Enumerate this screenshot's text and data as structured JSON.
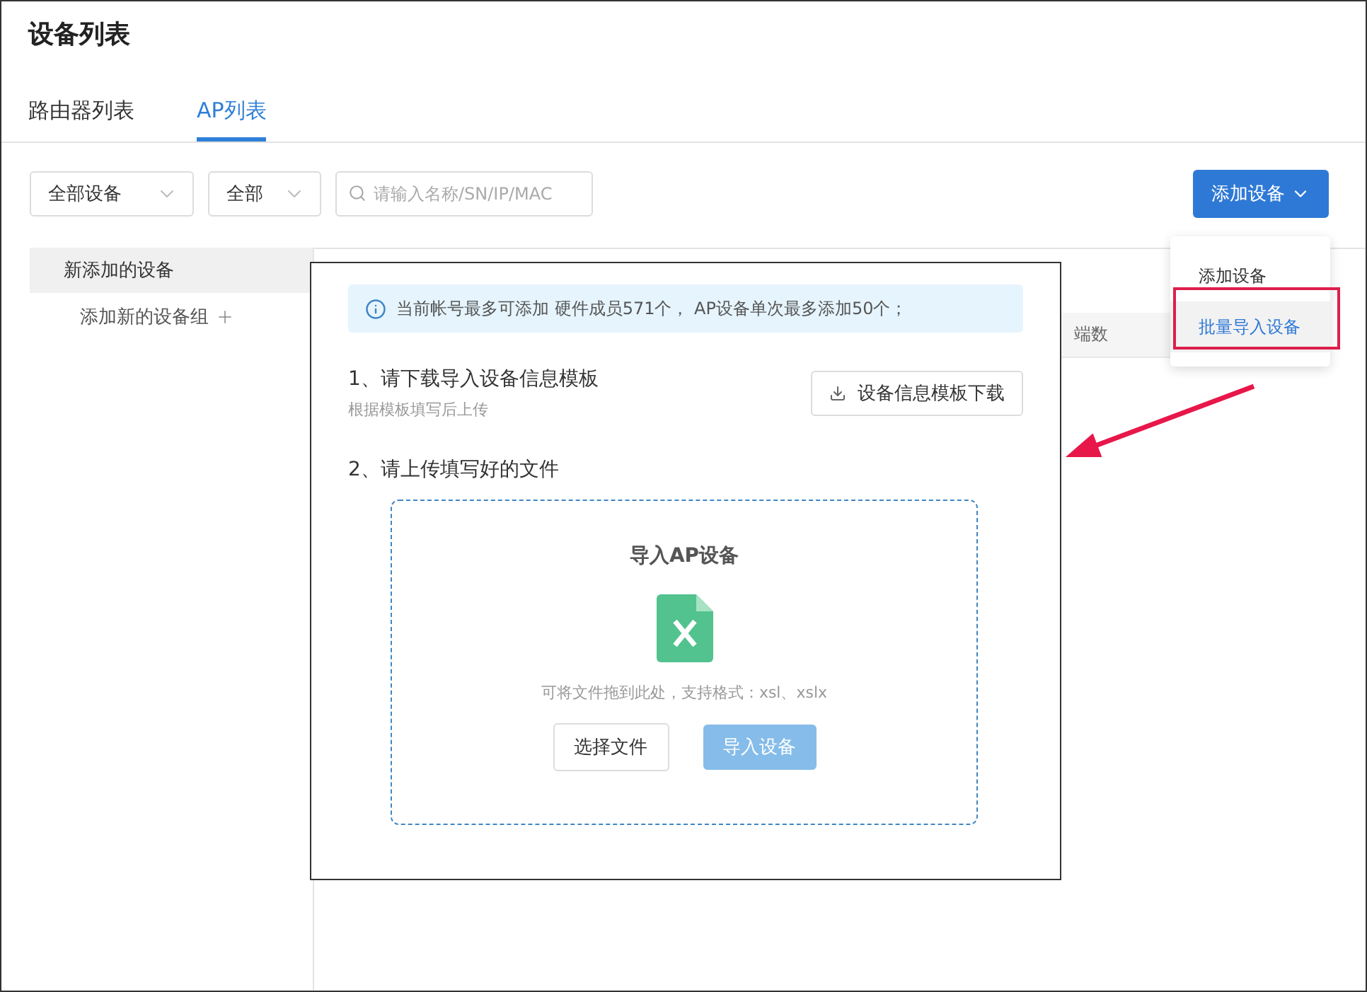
{
  "page": {
    "title": "设备列表"
  },
  "tabs": [
    {
      "label": "路由器列表",
      "selected": false
    },
    {
      "label": "AP列表",
      "selected": true
    }
  ],
  "filters": {
    "selects": [
      {
        "value": "全部设备"
      },
      {
        "value": "全部"
      }
    ],
    "search": {
      "placeholder": "请输入名称/SN/IP/MAC"
    }
  },
  "add_button": {
    "label": "添加设备",
    "expanded": true
  },
  "dropdown": {
    "items": [
      {
        "label": "添加设备",
        "selected": false
      },
      {
        "label": "批量导入设备",
        "selected": true
      }
    ]
  },
  "sidebar": {
    "items": [
      {
        "label": "新添加的设备",
        "selected": true
      }
    ],
    "add_group": "添加新的设备组"
  },
  "table": {
    "columns": [
      "端数"
    ]
  },
  "dialog": {
    "notice": "当前帐号最多可添加 硬件成员571个， AP设备单次最多添加50个；",
    "step_1": {
      "title": "1、请下载导入设备信息模板",
      "hint": "根据模板填写后上传",
      "button": "设备信息模板下载"
    },
    "step_2": {
      "title": "2、请上传填写好的文件"
    },
    "upload": {
      "title": "导入AP设备",
      "hint": "可将文件拖到此处，支持格式：xsl、xslx",
      "buttons": [
        {
          "label": "选择文件",
          "disabled": false
        },
        {
          "label": "导入设备",
          "disabled": true
        }
      ]
    }
  }
}
